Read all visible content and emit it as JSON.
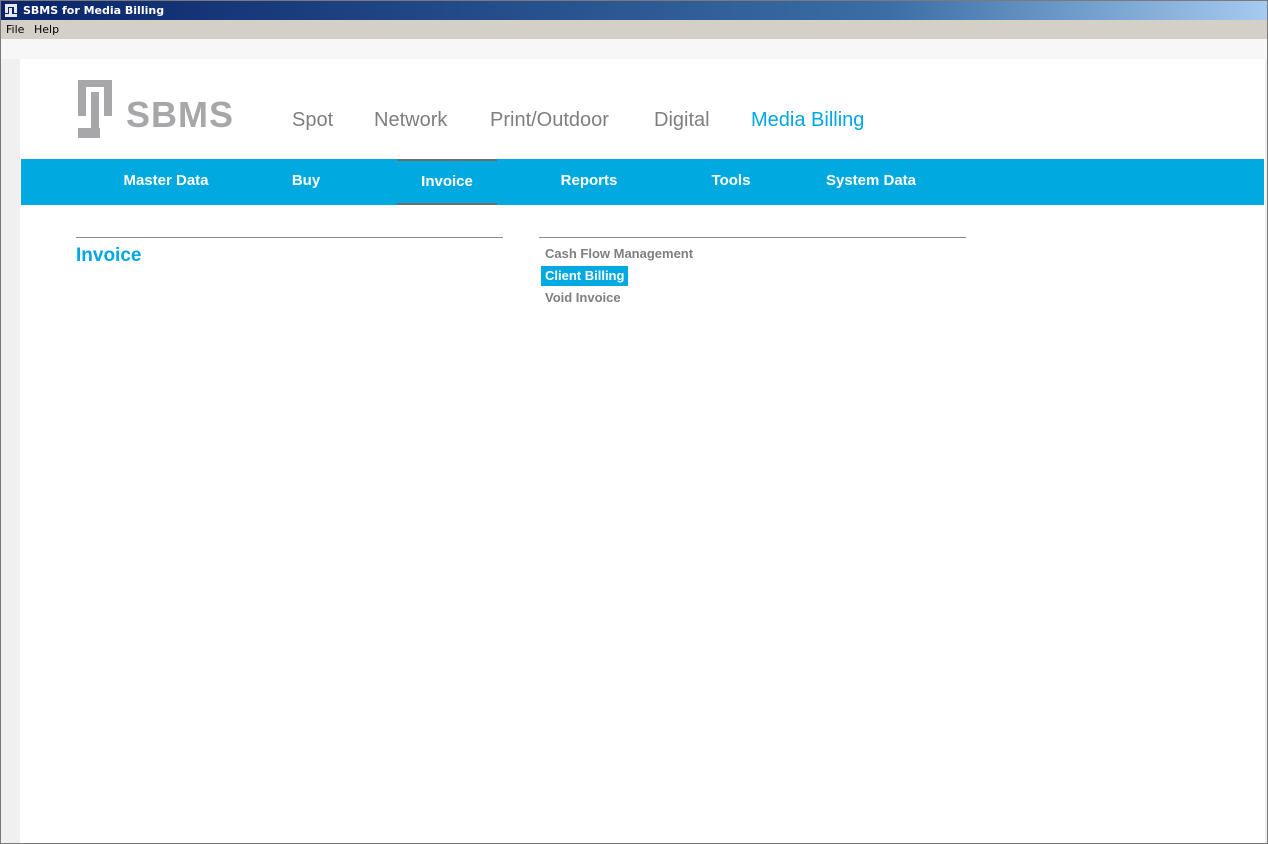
{
  "window": {
    "title": "SBMS for Media Billing"
  },
  "menubar": {
    "items": [
      "File",
      "Help"
    ]
  },
  "brand": {
    "wordmark": "SBMS"
  },
  "top_nav": {
    "items": [
      "Spot",
      "Network",
      "Print/Outdoor",
      "Digital",
      "Media Billing"
    ],
    "active": "Media Billing",
    "active_color": "#00a7e0",
    "inactive_color": "#7f7f81"
  },
  "sub_nav": {
    "background": "#00a9e0",
    "tabs": [
      "Master Data",
      "Buy",
      "Invoice",
      "Reports",
      "Tools",
      "System Data"
    ],
    "active": "Invoice"
  },
  "section": {
    "title": "Invoice",
    "actions": [
      "Cash Flow Management",
      "Client Billing",
      "Void Invoice"
    ],
    "selected_action": "Client Billing"
  },
  "icons": [
    "sbms-logo-icon"
  ]
}
